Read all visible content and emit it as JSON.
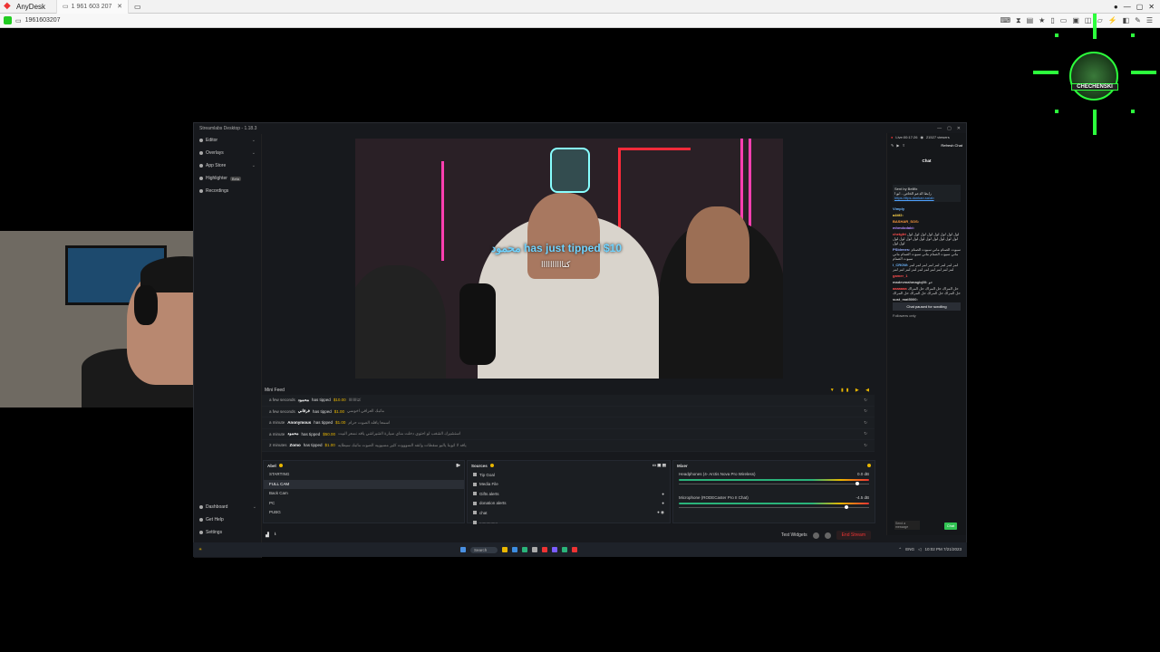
{
  "anydesk": {
    "app_title": "AnyDesk",
    "tab_label": "1 961 603 207",
    "address": "1961603207"
  },
  "streamlabs": {
    "window_title": "Streamlabs Desktop - 1.18.3",
    "nav": [
      {
        "label": "Editor"
      },
      {
        "label": "Overlays"
      },
      {
        "label": "App Store"
      },
      {
        "label": "Highlighter",
        "badge": "Beta"
      },
      {
        "label": "Recordings"
      }
    ],
    "nav_bottom": [
      {
        "label": "Dashboard"
      },
      {
        "label": "Get Help"
      },
      {
        "label": "Settings"
      }
    ],
    "username": "abel",
    "stream_overlay": {
      "tip_text": "محمود has just tipped $10",
      "tip_message": "كثاااااااااا"
    },
    "mini_feed": {
      "title": "Mini Feed",
      "rows": [
        {
          "time": "a few seconds",
          "name": "محمود",
          "action": "has tipped",
          "amount": "$10.00",
          "message": "كثاااااااا"
        },
        {
          "time": "a few seconds",
          "name": "فرقاني",
          "action": "has tipped",
          "amount": "$1.00",
          "message": "ماتبك العراقي اخوسي"
        },
        {
          "time": "a minute",
          "name": "Anonymous",
          "action": "has tipped",
          "amount": "$1.00",
          "message": "اسمعا ياقله الصوت حرام"
        },
        {
          "time": "a minute",
          "name": "محمود",
          "action": "has tipped",
          "amount": "$50.00",
          "message": "استشيرك الشغب لو احتوي دخلت مناي سيارة الشيراشي ياقه نسعر البيت"
        },
        {
          "time": "2 minutes",
          "name": "Zomo",
          "action": "has tipped",
          "amount": "$1.00",
          "message": "ياقه لا اتوبنا يالبو سقطات وانقه السوووت كثير مسيوييه الصوت ماتبك سيطايه"
        }
      ]
    },
    "scenes": {
      "title": "Abel",
      "items": [
        "STARTING",
        "FULL CAM",
        "Back Cam",
        "PC",
        "PUBG"
      ],
      "selected_index": 1
    },
    "sources": {
      "title": "Sources",
      "items": [
        "Tip Goal",
        "Media File",
        "Gifts alerts",
        "donation alerts",
        "chat",
        "................"
      ]
    },
    "mixer": {
      "title": "Mixer",
      "channels": [
        {
          "name": "Headphones (4- Arctis Nova Pro Wireless)",
          "db": "0.0 dB",
          "level": 0.93
        },
        {
          "name": "Microphone (RODECaster Pro II Chat)",
          "db": "-4.5 dB",
          "level": 0.87
        }
      ]
    },
    "bottom": {
      "test_widgets": "Test Widgets",
      "end_stream": "End Stream"
    },
    "chat": {
      "live_time": "Live:00:17:26",
      "viewers": "21527 viewers",
      "refresh": "Refresh Chat",
      "title": "Chat",
      "pinned_by": "Sent by Bellfix",
      "pinned_text": "رابط الدعم الخاص - ابو ا",
      "pinned_link": "https://ttps.donkan.sa/ab",
      "messages": [
        {
          "user": "Vimply",
          "text": "",
          "color": "#6fb8ff"
        },
        {
          "user": "a4itf2:",
          "text": "",
          "color": "#ffd54a"
        },
        {
          "user": "BASHAR_SOS:",
          "text": "",
          "color": "#ff9a3c"
        },
        {
          "user": "mhmdodabi:",
          "text": "",
          "color": "#b48cff"
        },
        {
          "user": "chetgfrt",
          "text": "لول لول لول لول لول لول لول لول لول لول لول لول لول لول لول لول لول لول لول لول",
          "color": "#ff4d4d"
        },
        {
          "user": "PSblenes:",
          "text": "سيوت الصنام ماني سيوت الصنام ماني سيوت الصنام ماني سيوت الصنام ماني سيوت الصنام",
          "color": "#9ab0ff"
        },
        {
          "user": "I_CROW:",
          "text": "لمر لمر لمر لمر لمر لمر لمر لمر لمر لمر لمر لمر لمر لمر لمر لمر لمر لمر",
          "color": "#6fb8ff"
        },
        {
          "user": "gamer_1",
          "text": "",
          "color": "#ff4d4d"
        },
        {
          "user": "madevmahmagiq00:",
          "text": "حو",
          "color": "#cccccc"
        },
        {
          "user": "aaaaaaa",
          "text": "حل المراك حل المراك حل المراك حل المراك حل المراك حل المراك حل المراك",
          "color": "#ff4d4d"
        },
        {
          "user": "sust_mat5000:",
          "text": "",
          "color": "#cccccc"
        }
      ],
      "paused": "Chat paused for scrolling",
      "followers_only": "Followers only",
      "input_placeholder": "Send a message",
      "chat_button": "Chat"
    },
    "taskbar": {
      "search": "Search",
      "time": "10:02 PM",
      "date": "7/21/2023",
      "lang": "ENG"
    }
  },
  "overlay_badge": {
    "text": "CHECHENSKI"
  },
  "colors": {
    "accent_yellow": "#e9b600",
    "live_red": "#e33333",
    "chat_green": "#31c453",
    "badge_green": "#2cff3c"
  }
}
